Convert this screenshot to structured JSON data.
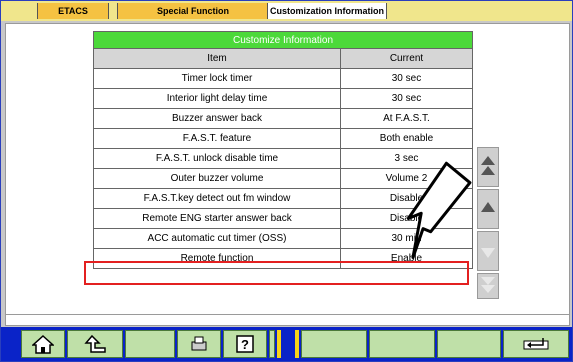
{
  "tabs": [
    {
      "label": "ETACS"
    },
    {
      "label": "Special Function"
    },
    {
      "label": "Customization Information"
    }
  ],
  "table": {
    "title": "Customize Information",
    "col_item": "Item",
    "col_current": "Current",
    "rows": [
      {
        "item": "Timer lock timer",
        "current": "30 sec"
      },
      {
        "item": "Interior light delay time",
        "current": "30 sec"
      },
      {
        "item": "Buzzer answer back",
        "current": "At F.A.S.T."
      },
      {
        "item": "F.A.S.T. feature",
        "current": "Both enable"
      },
      {
        "item": "F.A.S.T. unlock disable time",
        "current": "3 sec"
      },
      {
        "item": "Outer buzzer volume",
        "current": "Volume 2"
      },
      {
        "item": "F.A.S.T.key detect out fm window",
        "current": "Disable"
      },
      {
        "item": "Remote ENG starter answer back",
        "current": "Disable"
      },
      {
        "item": "ACC automatic cut timer (OSS)",
        "current": "30 min"
      },
      {
        "item": "Remote function",
        "current": "Enable"
      }
    ],
    "highlighted_row": "ACC automatic cut timer (OSS)"
  },
  "colors": {
    "tab_bar": "#f0e68c",
    "tab_active": "#ffffff",
    "header_green": "#4cd93a",
    "highlight": "#e32020",
    "toolbar_bg": "#0a23c8",
    "toolbar_button": "#bfe0a8"
  },
  "scroll_icons": [
    "double-up-arrow-icon",
    "up-arrow-icon",
    "down-arrow-icon",
    "double-down-arrow-icon"
  ],
  "toolbar_icons": [
    "home-icon",
    "back-icon",
    "print-icon",
    "help-icon",
    "enter-icon"
  ]
}
